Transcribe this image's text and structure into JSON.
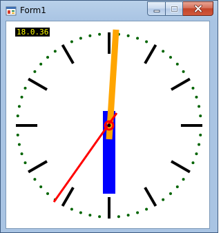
{
  "window": {
    "title": "Form1",
    "icon": "app-icon"
  },
  "caption_buttons": [
    {
      "name": "minimize-button",
      "icon": "minimize-icon"
    },
    {
      "name": "maximize-button",
      "icon": "maximize-icon"
    },
    {
      "name": "close-button",
      "icon": "close-icon"
    }
  ],
  "clock": {
    "time_label": "18.0.36",
    "label_background": "#000000",
    "label_color": "#ffff00",
    "hour_hand_color": "#0000ff",
    "minute_hand_color": "#ffa500",
    "second_hand_color": "#ff0000",
    "tick_color": "#000000",
    "dot_color": "#006400"
  }
}
